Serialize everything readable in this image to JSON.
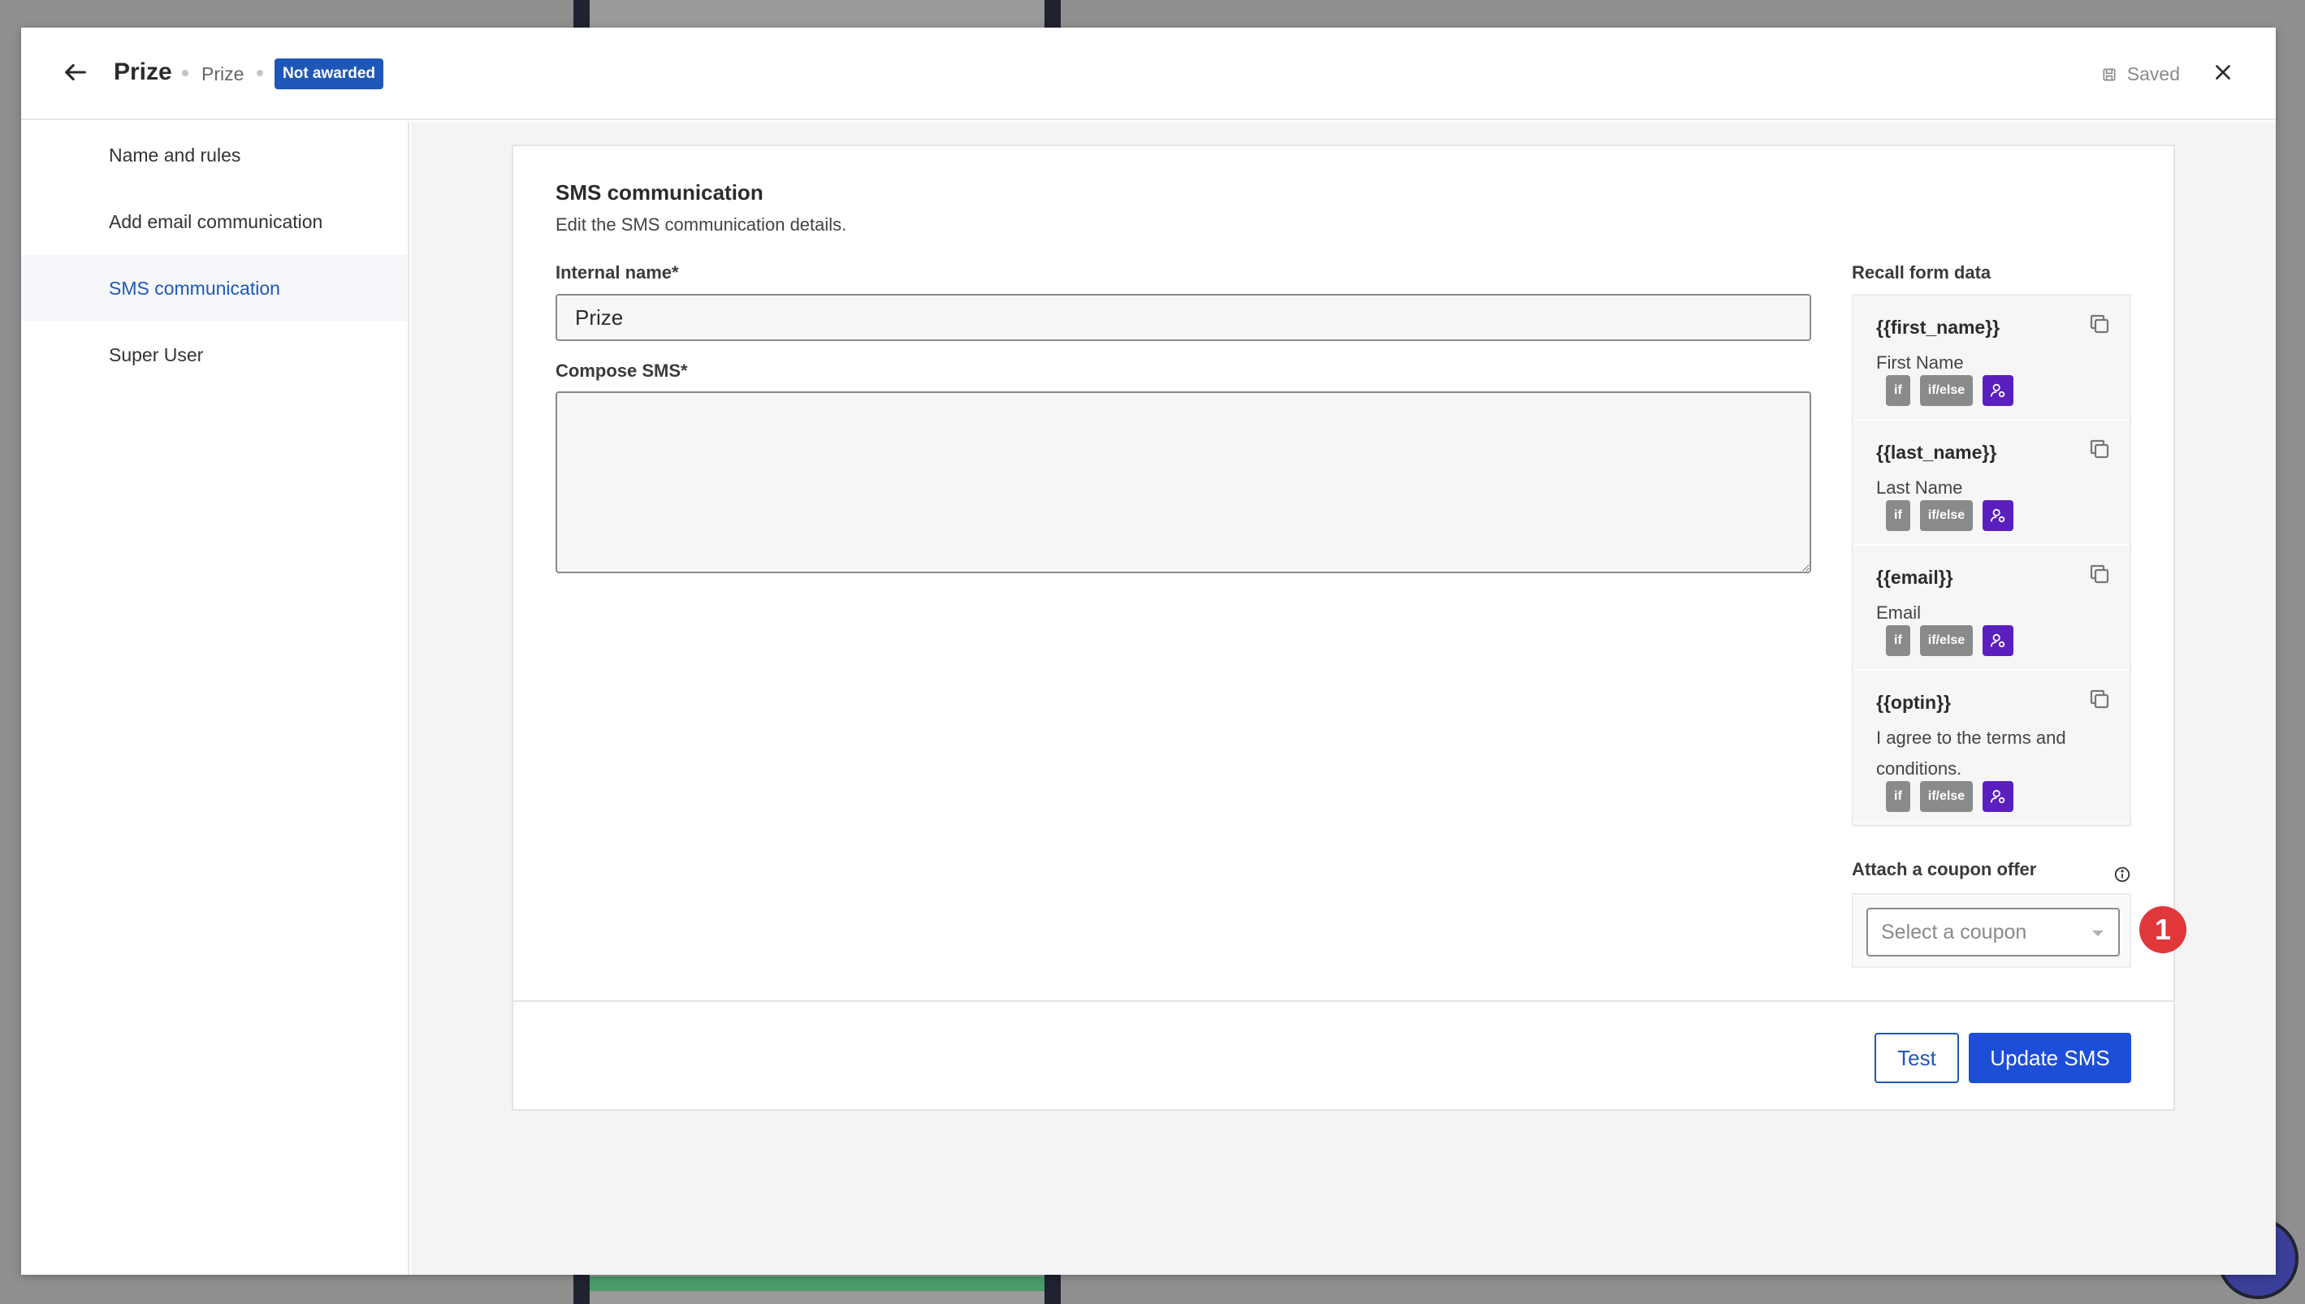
{
  "header": {
    "title": "Prize",
    "subtitle": "Prize",
    "badge": "Not awarded",
    "saved_label": "Saved"
  },
  "sidebar": {
    "items": [
      {
        "label": "Name and rules"
      },
      {
        "label": "Add email communication"
      },
      {
        "label": "SMS communication",
        "active": true
      },
      {
        "label": "Super User"
      }
    ]
  },
  "form": {
    "title": "SMS communication",
    "description": "Edit the SMS communication details.",
    "internal_name_label": "Internal name*",
    "internal_name_value": "Prize",
    "compose_label": "Compose SMS*",
    "compose_value": ""
  },
  "recall": {
    "label": "Recall form data",
    "items": [
      {
        "variable": "{{first_name}}",
        "description": "First Name"
      },
      {
        "variable": "{{last_name}}",
        "description": "Last Name"
      },
      {
        "variable": "{{email}}",
        "description": "Email"
      },
      {
        "variable": "{{optin}}",
        "description": "I agree to the terms and conditions."
      }
    ],
    "tag_if": "if",
    "tag_ifelse": "if/else"
  },
  "coupon": {
    "label": "Attach a coupon offer",
    "placeholder": "Select a coupon",
    "marker": "1"
  },
  "footer": {
    "test_label": "Test",
    "update_label": "Update SMS"
  },
  "colors": {
    "accent": "#1d4ed8",
    "badge": "#1f57b8",
    "person_tag": "#5b1fbf",
    "marker": "#e0383a"
  }
}
